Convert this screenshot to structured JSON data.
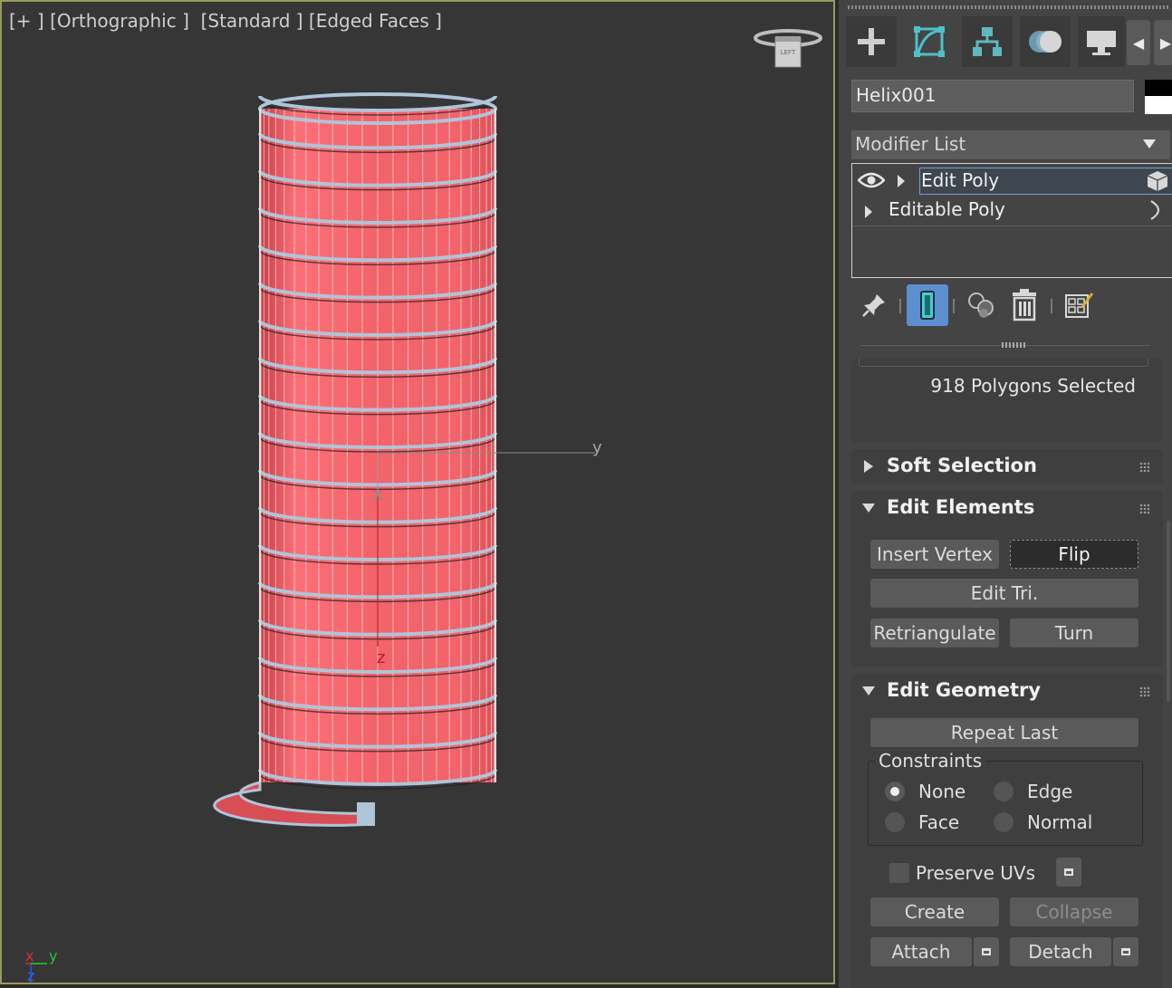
{
  "viewport": {
    "label_plus": "[+ ]",
    "label_view": "[Orthographic ]",
    "label_shading": "[Standard ]",
    "label_edges": "[Edged Faces ]",
    "viewcube_text": "LEFT",
    "gizmo_axis_y": "y",
    "gizmo_axis_x": "x",
    "gizmo_axis_z": "z",
    "triad_x": "x",
    "triad_y": "y",
    "triad_z": "z",
    "colors": {
      "mesh_face": "#f2636a",
      "mesh_edge": "#b0c4d8",
      "frame": "#9a9a5a"
    }
  },
  "command_panel": {
    "tabs": [
      {
        "name": "create-tab-icon",
        "active": false
      },
      {
        "name": "modify-tab-icon",
        "active": true
      },
      {
        "name": "hierarchy-tab-icon",
        "active": false
      },
      {
        "name": "motion-tab-icon",
        "active": false
      },
      {
        "name": "display-tab-icon",
        "active": false
      }
    ],
    "object_name": "Helix001",
    "modifier_list_label": "Modifier List",
    "stack": [
      {
        "label": "Edit Poly",
        "selected": true
      },
      {
        "label": "Editable Poly",
        "selected": false
      }
    ],
    "toolbar_icons": [
      "pin-stack-icon",
      "show-end-result-icon",
      "make-unique-icon",
      "remove-modifier-icon",
      "configure-modifier-sets-icon"
    ]
  },
  "selection_info": {
    "text": "918 Polygons Selected"
  },
  "rollouts": {
    "soft_selection": {
      "title": "Soft Selection",
      "expanded": false
    },
    "edit_elements": {
      "title": "Edit Elements",
      "expanded": true,
      "insert_vertex": "Insert Vertex",
      "flip": "Flip",
      "edit_tri": "Edit Tri.",
      "retriangulate": "Retriangulate",
      "turn": "Turn"
    },
    "edit_geometry": {
      "title": "Edit Geometry",
      "expanded": true,
      "repeat_last": "Repeat Last",
      "constraints_label": "Constraints",
      "none": "None",
      "edge": "Edge",
      "face": "Face",
      "normal": "Normal",
      "constraint_selected": "None",
      "preserve_uvs": "Preserve UVs",
      "preserve_uvs_checked": false,
      "create": "Create",
      "collapse": "Collapse",
      "attach": "Attach",
      "detach": "Detach"
    }
  }
}
